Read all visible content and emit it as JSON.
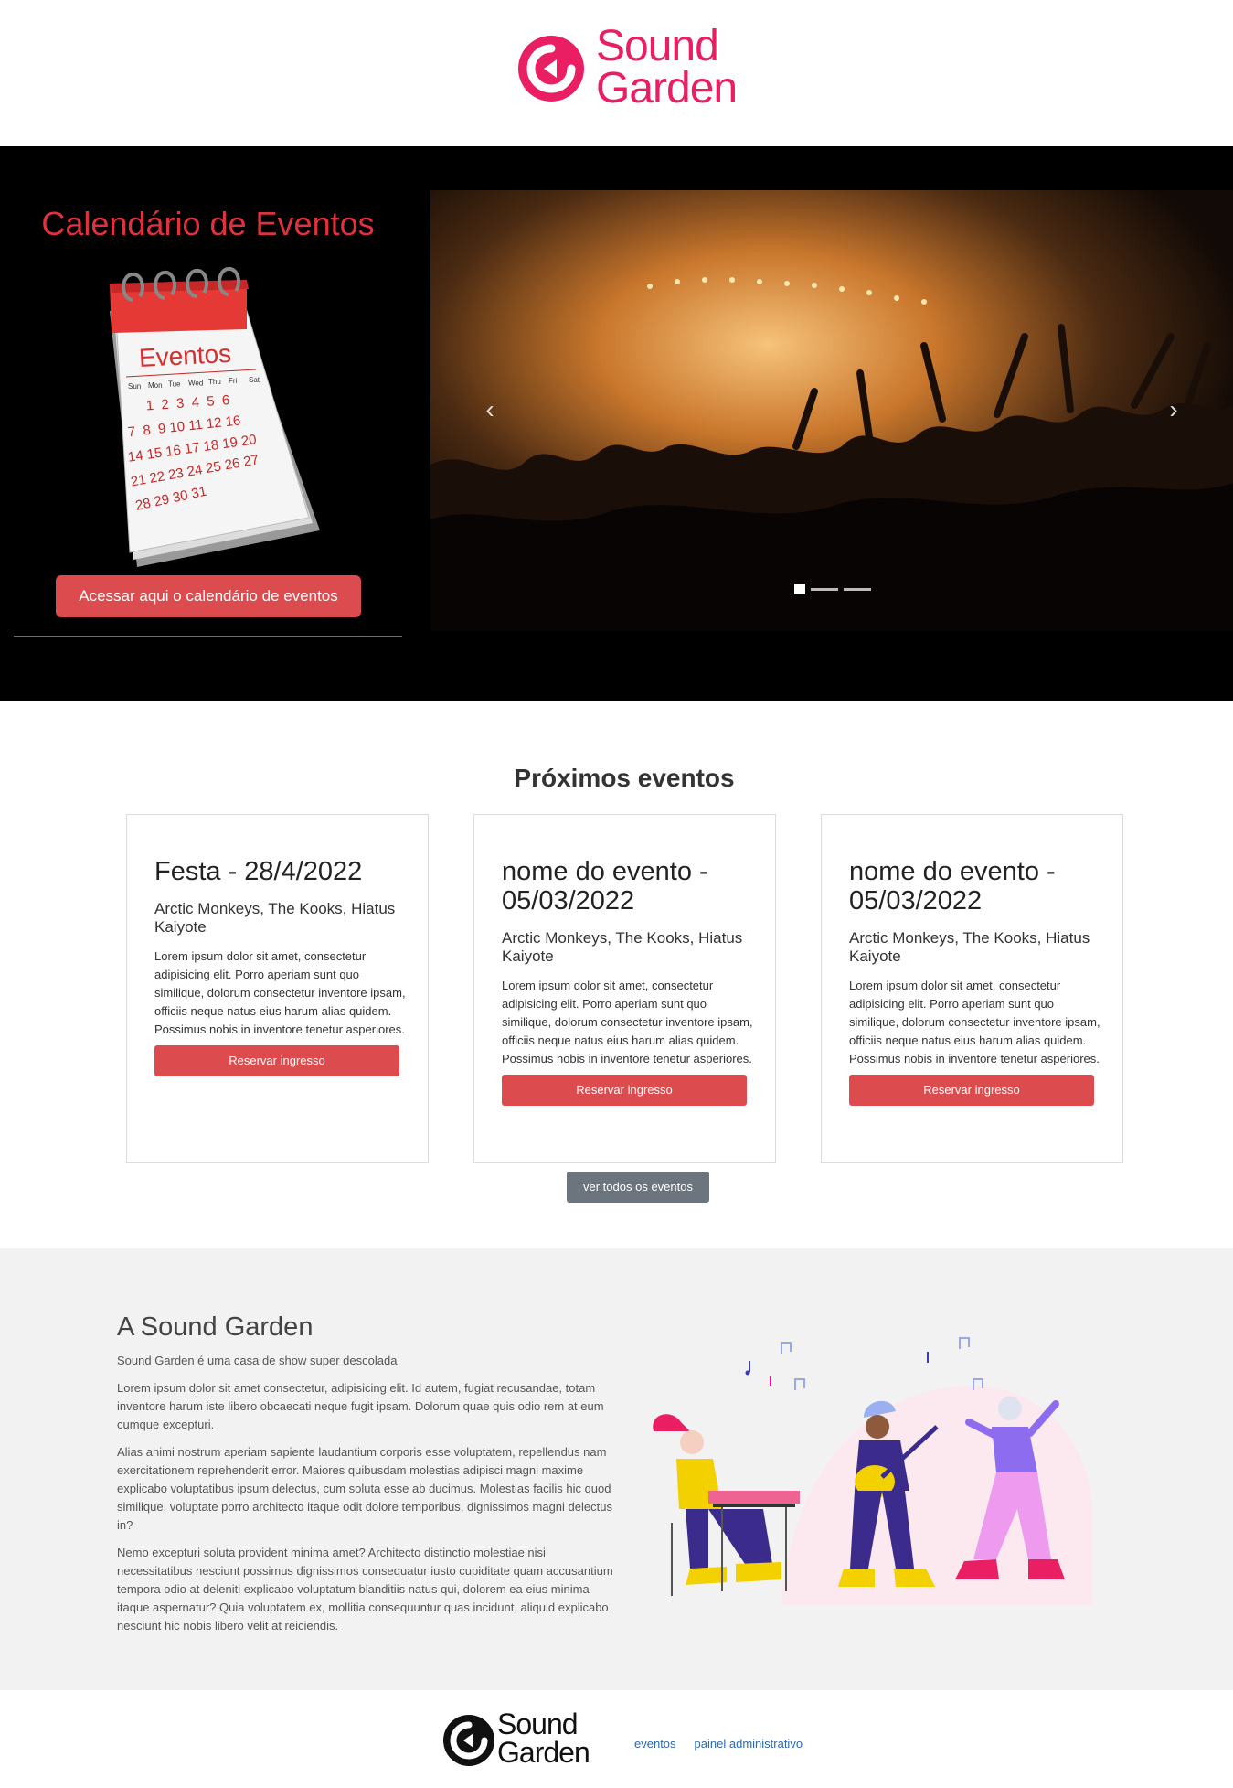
{
  "header": {
    "logo_line1": "Sound",
    "logo_line2": "Garden",
    "brand_color": "#e91e63"
  },
  "hero": {
    "calendar_title": "Calendário de Eventos",
    "calendar_image_label": "Eventos",
    "calendar_days": [
      "Sun",
      "Mon",
      "Tue",
      "Wed",
      "Thu",
      "Fri",
      "Sat"
    ],
    "calendar_button": "Acessar aqui o calendário de eventos",
    "carousel_prev": "‹",
    "carousel_next": "›",
    "carousel_slides": 3,
    "carousel_active_slide": 1
  },
  "events": {
    "title": "Próximos eventos",
    "cards": [
      {
        "title": "Festa - 28/4/2022",
        "artists": "Arctic Monkeys, The Kooks, Hiatus Kaiyote",
        "description": "Lorem ipsum dolor sit amet, consectetur adipisicing elit. Porro aperiam sunt quo similique, dolorum consectetur inventore ipsam, officiis neque natus eius harum alias quidem. Possimus nobis in inventore tenetur asperiores.",
        "button": "Reservar ingresso"
      },
      {
        "title": "nome do evento - 05/03/2022",
        "artists": "Arctic Monkeys, The Kooks, Hiatus Kaiyote",
        "description": "Lorem ipsum dolor sit amet, consectetur adipisicing elit. Porro aperiam sunt quo similique, dolorum consectetur inventore ipsam, officiis neque natus eius harum alias quidem. Possimus nobis in inventore tenetur asperiores.",
        "button": "Reservar ingresso"
      },
      {
        "title": "nome do evento - 05/03/2022",
        "artists": "Arctic Monkeys, The Kooks, Hiatus Kaiyote",
        "description": "Lorem ipsum dolor sit amet, consectetur adipisicing elit. Porro aperiam sunt quo similique, dolorum consectetur inventore ipsam, officiis neque natus eius harum alias quidem. Possimus nobis in inventore tenetur asperiores.",
        "button": "Reservar ingresso"
      }
    ],
    "all_events_button": "ver todos os eventos"
  },
  "about": {
    "title": "A Sound Garden",
    "lead": "Sound Garden é uma casa de show super descolada",
    "paragraphs": [
      "Lorem ipsum dolor sit amet consectetur, adipisicing elit. Id autem, fugiat recusandae, totam inventore harum iste libero obcaecati neque fugit ipsam. Dolorum quae quis odio rem at eum cumque excepturi.",
      "Alias animi nostrum aperiam sapiente laudantium corporis esse voluptatem, repellendus nam exercitationem reprehenderit error. Maiores quibusdam molestias adipisci magni maxime explicabo voluptatibus ipsum delectus, cum soluta esse ab ducimus. Molestias facilis hic quod similique, voluptate porro architecto itaque odit dolore temporibus, dignissimos magni delectus in?",
      "Nemo excepturi soluta provident minima amet? Architecto distinctio molestiae nisi necessitatibus nesciunt possimus dignissimos consequatur iusto cupiditate quam accusantium tempora odio at deleniti explicabo voluptatum blanditiis natus qui, dolorem ea eius minima itaque aspernatur? Quia voluptatem ex, mollitia consequuntur quas incidunt, aliquid explicabo nesciunt hic nobis libero velit at reiciendis."
    ]
  },
  "footer": {
    "logo_line1": "Sound",
    "logo_line2": "Garden",
    "links": [
      "eventos",
      "painel administrativo"
    ]
  }
}
